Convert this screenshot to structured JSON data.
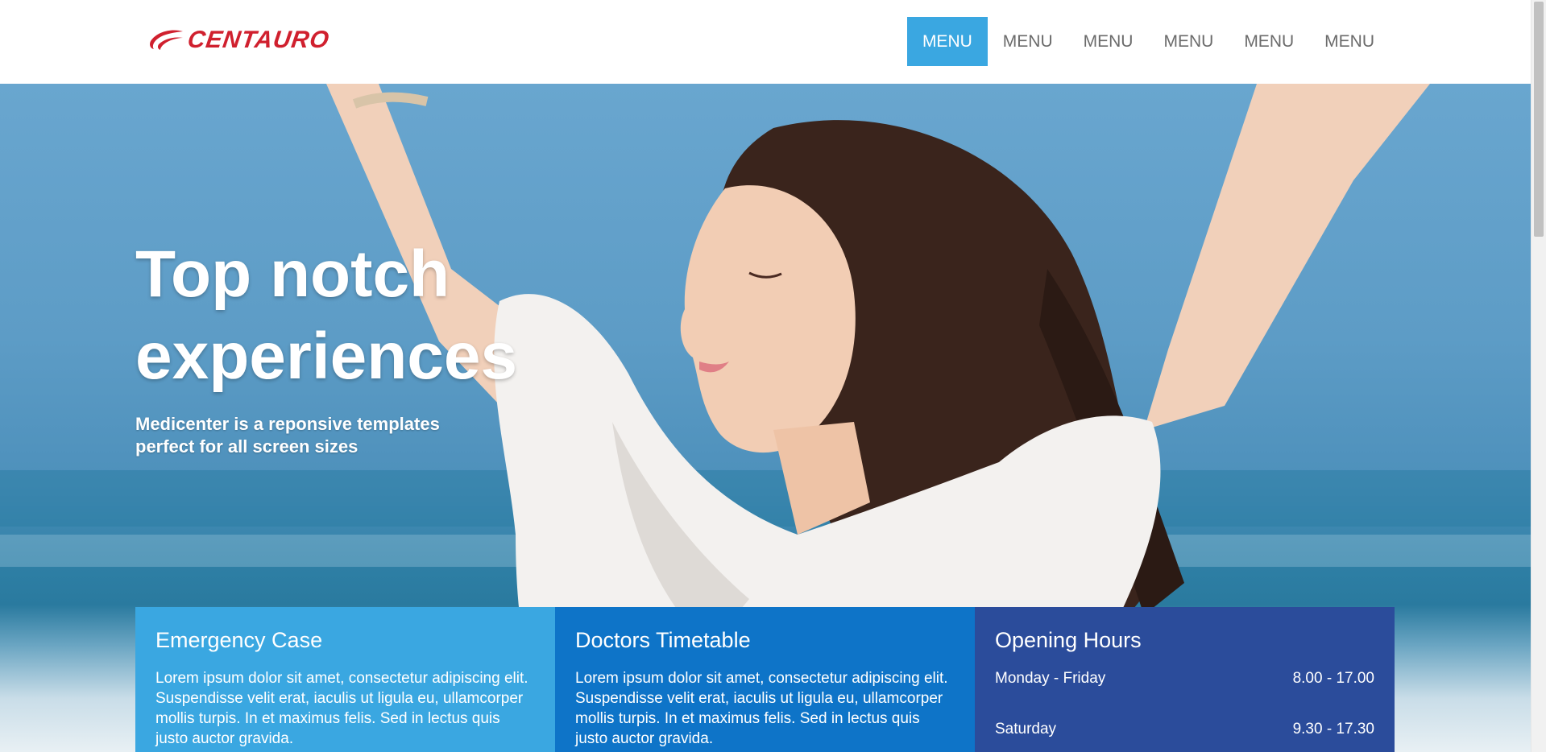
{
  "header": {
    "logo_text": "CENTAURO",
    "nav": [
      {
        "label": "MENU",
        "active": true
      },
      {
        "label": "MENU",
        "active": false
      },
      {
        "label": "MENU",
        "active": false
      },
      {
        "label": "MENU",
        "active": false
      },
      {
        "label": "MENU",
        "active": false
      },
      {
        "label": "MENU",
        "active": false
      }
    ]
  },
  "hero": {
    "title_line1": "Top notch",
    "title_line2": "experiences",
    "subtitle_line1": "Medicenter is a reponsive templates",
    "subtitle_line2": "perfect for all screen sizes"
  },
  "boxes": {
    "emergency": {
      "title": "Emergency Case",
      "text": "Lorem ipsum dolor sit amet, consectetur adipiscing elit. Suspendisse velit erat, iaculis ut ligula eu, ullamcorper mollis turpis. In et maximus felis. Sed in lectus quis justo auctor gravida."
    },
    "timetable": {
      "title": "Doctors Timetable",
      "text": "Lorem ipsum dolor sit amet, consectetur adipiscing elit. Suspendisse velit erat, iaculis ut ligula eu, ullamcorper mollis turpis. In et maximus felis. Sed in lectus quis justo auctor gravida."
    },
    "hours": {
      "title": "Opening Hours",
      "rows": [
        {
          "day": "Monday - Friday",
          "time": "8.00 - 17.00"
        },
        {
          "day": "Saturday",
          "time": "9.30 - 17.30"
        }
      ]
    }
  },
  "colors": {
    "brand_red": "#d0202e",
    "nav_active": "#3aa7e1",
    "box1": "#3aa7e1",
    "box2": "#0e74c8",
    "box3": "#2b4c9b"
  },
  "icons": {
    "logo_mark": "swoosh-logo-icon"
  }
}
